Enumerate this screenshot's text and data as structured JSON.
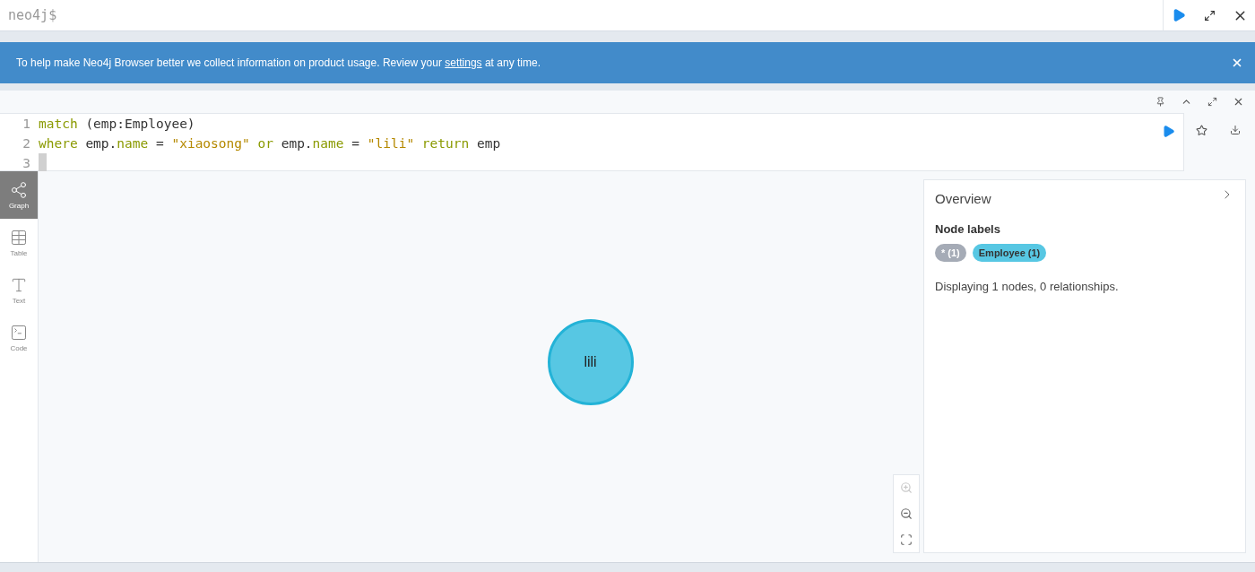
{
  "editor": {
    "placeholder": "neo4j$"
  },
  "banner": {
    "before": "To help make Neo4j Browser better we collect information on product usage. Review your ",
    "link": "settings",
    "after": " at any time."
  },
  "query": {
    "lines": [
      {
        "number": "1",
        "tokens": [
          {
            "kind": "keyword",
            "text": "match"
          },
          {
            "kind": "plain",
            "text": " (emp:Employee)"
          }
        ]
      },
      {
        "number": "2",
        "tokens": [
          {
            "kind": "keyword",
            "text": "where"
          },
          {
            "kind": "plain",
            "text": " emp."
          },
          {
            "kind": "property",
            "text": "name"
          },
          {
            "kind": "plain",
            "text": " = "
          },
          {
            "kind": "string",
            "text": "\"xiaosong\""
          },
          {
            "kind": "keyword",
            "text": " or"
          },
          {
            "kind": "plain",
            "text": " emp."
          },
          {
            "kind": "property",
            "text": "name"
          },
          {
            "kind": "plain",
            "text": " = "
          },
          {
            "kind": "string",
            "text": "\"lili\""
          },
          {
            "kind": "keyword",
            "text": " return"
          },
          {
            "kind": "plain",
            "text": " emp"
          }
        ]
      },
      {
        "number": "3"
      }
    ]
  },
  "views": [
    {
      "kind": "graph",
      "label": "Graph",
      "selected": true
    },
    {
      "kind": "table",
      "label": "Table",
      "selected": false
    },
    {
      "kind": "text",
      "label": "Text",
      "selected": false
    },
    {
      "kind": "code",
      "label": "Code",
      "selected": false
    }
  ],
  "node": {
    "caption": "lili",
    "color": "#57c7e3"
  },
  "overview": {
    "title": "Overview",
    "section": "Node labels",
    "labels": [
      {
        "text": "* (1)",
        "color": "#a5abb6"
      },
      {
        "text": "Employee (1)",
        "color": "#57c7e3"
      }
    ],
    "summary": "Displaying 1 nodes, 0 relationships."
  },
  "zoom_controls": [
    {
      "kind": "zoom-in",
      "disabled": true
    },
    {
      "kind": "zoom-out",
      "disabled": false
    },
    {
      "kind": "fit",
      "disabled": false
    }
  ]
}
